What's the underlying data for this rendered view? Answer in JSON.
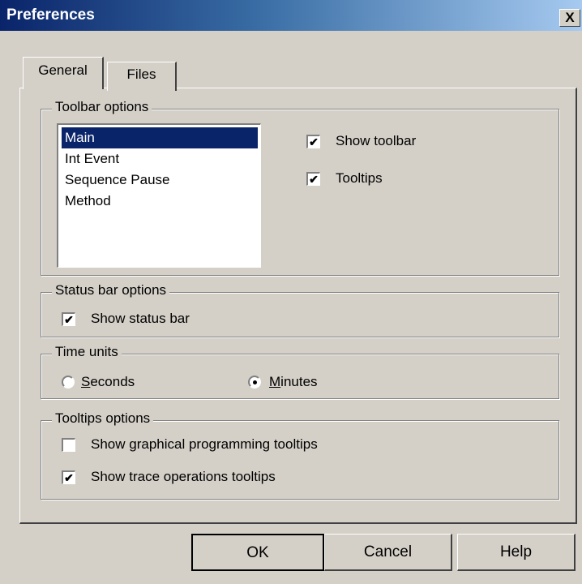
{
  "window": {
    "title": "Preferences",
    "close_glyph": "X"
  },
  "tabs": [
    {
      "label": "General",
      "active": true
    },
    {
      "label": "Files",
      "active": false
    }
  ],
  "toolbar_options": {
    "legend": "Toolbar options",
    "list_items": [
      "Main",
      "Int Event",
      "Sequence Pause",
      "Method"
    ],
    "selected": "Main",
    "show_toolbar": {
      "label": "Show toolbar",
      "checked": true
    },
    "tooltips": {
      "label": "Tooltips",
      "checked": true
    }
  },
  "status_bar_options": {
    "legend": "Status bar options",
    "show_status_bar": {
      "label": "Show status bar",
      "checked": true
    }
  },
  "time_units": {
    "legend": "Time units",
    "seconds": {
      "label_first": "S",
      "label_rest": "econds",
      "selected": false
    },
    "minutes": {
      "label_first": "M",
      "label_rest": "inutes",
      "selected": true
    }
  },
  "tooltips_options": {
    "legend": "Tooltips options",
    "graphical": {
      "label": "Show graphical programming tooltips",
      "checked": false
    },
    "trace": {
      "label": "Show trace operations tooltips",
      "checked": true
    }
  },
  "buttons": {
    "ok": "OK",
    "cancel": "Cancel",
    "help": "Help"
  },
  "colors": {
    "dialog_bg": "#d4d0c8",
    "title_start": "#0a246a",
    "title_end": "#a6caf0",
    "selection": "#0a246a"
  },
  "check_glyph": "✔"
}
